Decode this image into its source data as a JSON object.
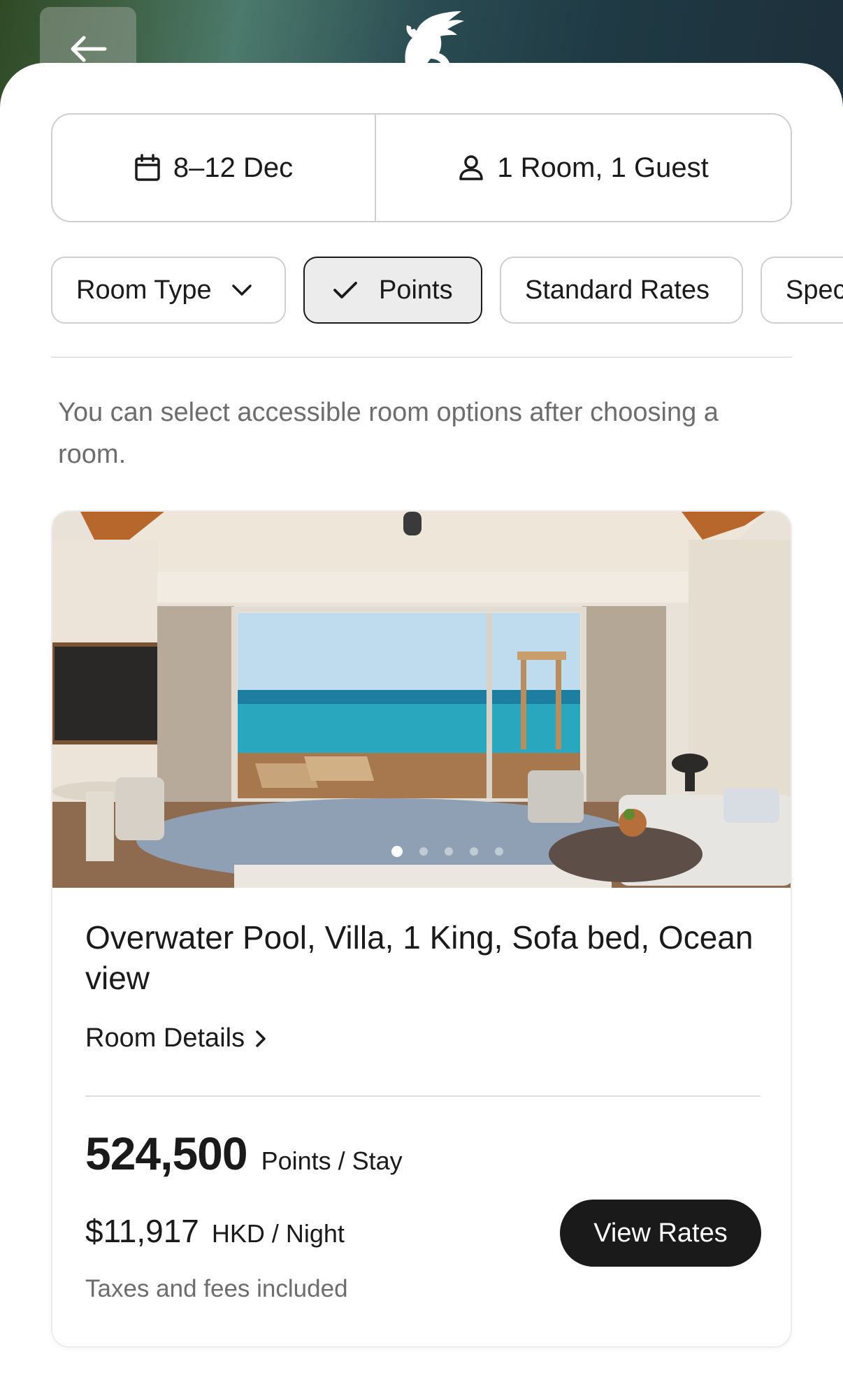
{
  "header": {
    "back_icon": "arrow-left-icon",
    "logo_icon": "griffin-logo-icon"
  },
  "search": {
    "dates": "8–12 Dec",
    "dates_icon": "calendar-icon",
    "guests": "1 Room, 1 Guest",
    "guests_icon": "person-icon"
  },
  "filters": [
    {
      "label": "Room Type",
      "icon": "chevron-down-icon",
      "selected": false
    },
    {
      "label": "Points",
      "icon": "checkmark-icon",
      "selected": true
    },
    {
      "label": "Standard Rates",
      "selected": false
    },
    {
      "label": "Spec",
      "selected": false
    }
  ],
  "note": "You can select accessible room options after choosing a room.",
  "room": {
    "title": "Overwater Pool, Villa, 1 King, Sofa bed, Ocean view",
    "details_label": "Room Details",
    "points": "524,500",
    "points_unit": "Points / Stay",
    "price": "$11,917",
    "price_unit": "HKD / Night",
    "taxes_note": "Taxes and fees included",
    "cta_label": "View Rates",
    "carousel": {
      "current": 1,
      "total": 5
    }
  },
  "colors": {
    "primary_button": "#1a1a1a",
    "muted_text": "#6d6d6d",
    "border": "#cfcfcf"
  }
}
